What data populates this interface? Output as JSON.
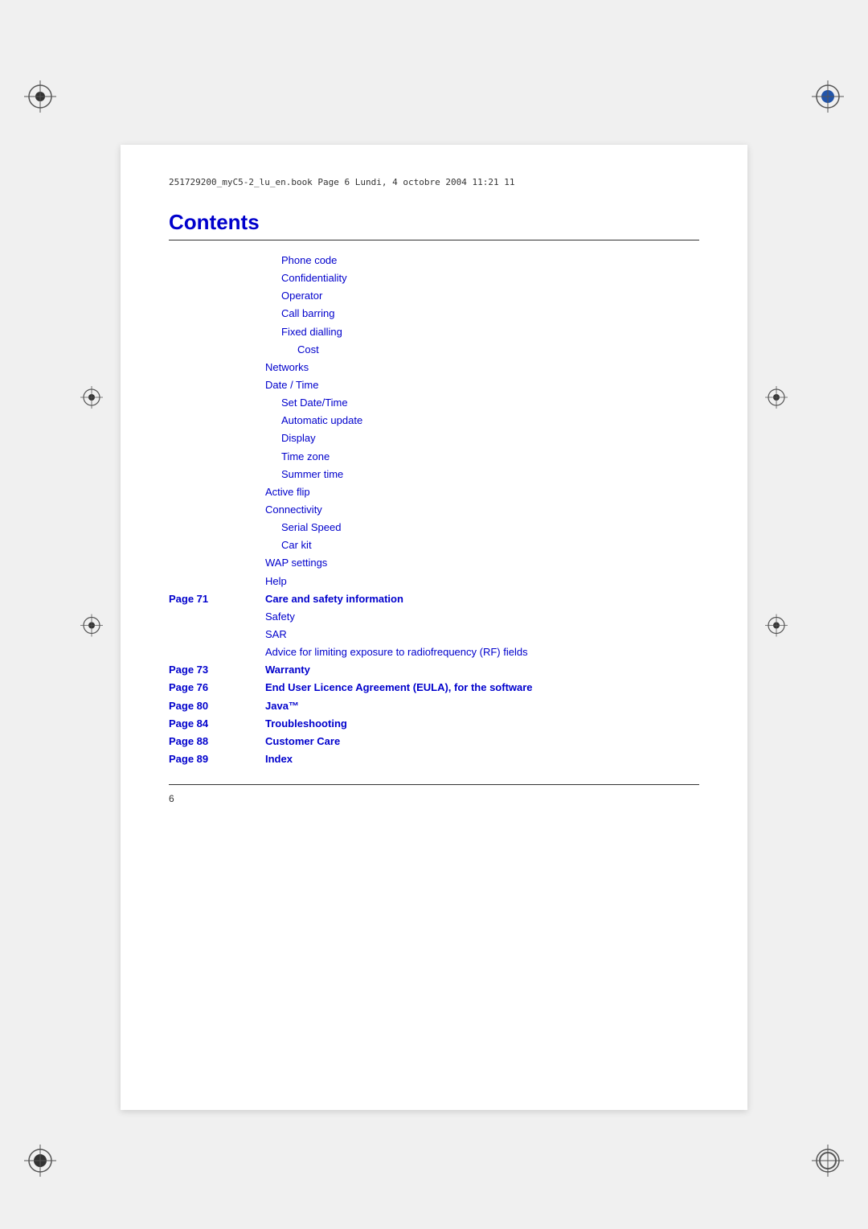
{
  "page": {
    "background_color": "#f0f0f0",
    "file_header": "251729200_myC5-2_lu_en.book  Page 6  Lundi, 4  octobre 2004  11:21  11",
    "title": "Contents",
    "page_number": "6"
  },
  "toc": {
    "entries": [
      {
        "page": "",
        "items": [
          {
            "text": "Phone code",
            "indent": 1,
            "bold": false
          },
          {
            "text": "Confidentiality",
            "indent": 1,
            "bold": false
          },
          {
            "text": "Operator",
            "indent": 1,
            "bold": false
          },
          {
            "text": "Call barring",
            "indent": 1,
            "bold": false
          },
          {
            "text": "Fixed dialling",
            "indent": 1,
            "bold": false
          },
          {
            "text": "Cost",
            "indent": 2,
            "bold": false
          },
          {
            "text": "Networks",
            "indent": 0,
            "bold": false
          },
          {
            "text": "Date / Time",
            "indent": 0,
            "bold": false
          },
          {
            "text": "Set Date/Time",
            "indent": 1,
            "bold": false
          },
          {
            "text": "Automatic update",
            "indent": 1,
            "bold": false
          },
          {
            "text": "Display",
            "indent": 1,
            "bold": false
          },
          {
            "text": "Time zone",
            "indent": 1,
            "bold": false
          },
          {
            "text": "Summer time",
            "indent": 1,
            "bold": false
          },
          {
            "text": "Active flip",
            "indent": 0,
            "bold": false
          },
          {
            "text": "Connectivity",
            "indent": 0,
            "bold": false
          },
          {
            "text": "Serial Speed",
            "indent": 1,
            "bold": false
          },
          {
            "text": "Car kit",
            "indent": 1,
            "bold": false
          },
          {
            "text": "WAP settings",
            "indent": 0,
            "bold": false
          },
          {
            "text": "Help",
            "indent": 0,
            "bold": false
          }
        ]
      },
      {
        "page": "Page 71",
        "items": [
          {
            "text": "Care and safety information",
            "indent": 0,
            "bold": true
          },
          {
            "text": "Safety",
            "indent": 0,
            "bold": false
          },
          {
            "text": "SAR",
            "indent": 0,
            "bold": false
          },
          {
            "text": "Advice for limiting exposure to radiofrequency (RF) fields",
            "indent": 0,
            "bold": false
          }
        ]
      },
      {
        "page": "Page 73",
        "items": [
          {
            "text": "Warranty",
            "indent": 0,
            "bold": true
          }
        ]
      },
      {
        "page": "Page 76",
        "items": [
          {
            "text": "End User Licence Agreement (EULA), for the software",
            "indent": 0,
            "bold": true
          }
        ]
      },
      {
        "page": "Page 80",
        "items": [
          {
            "text": "Java™",
            "indent": 0,
            "bold": true
          }
        ]
      },
      {
        "page": "Page 84",
        "items": [
          {
            "text": "Troubleshooting",
            "indent": 0,
            "bold": true
          }
        ]
      },
      {
        "page": "Page 88",
        "items": [
          {
            "text": "Customer Care",
            "indent": 0,
            "bold": true
          }
        ]
      },
      {
        "page": "Page 89",
        "items": [
          {
            "text": "Index",
            "indent": 0,
            "bold": true
          }
        ]
      }
    ]
  }
}
